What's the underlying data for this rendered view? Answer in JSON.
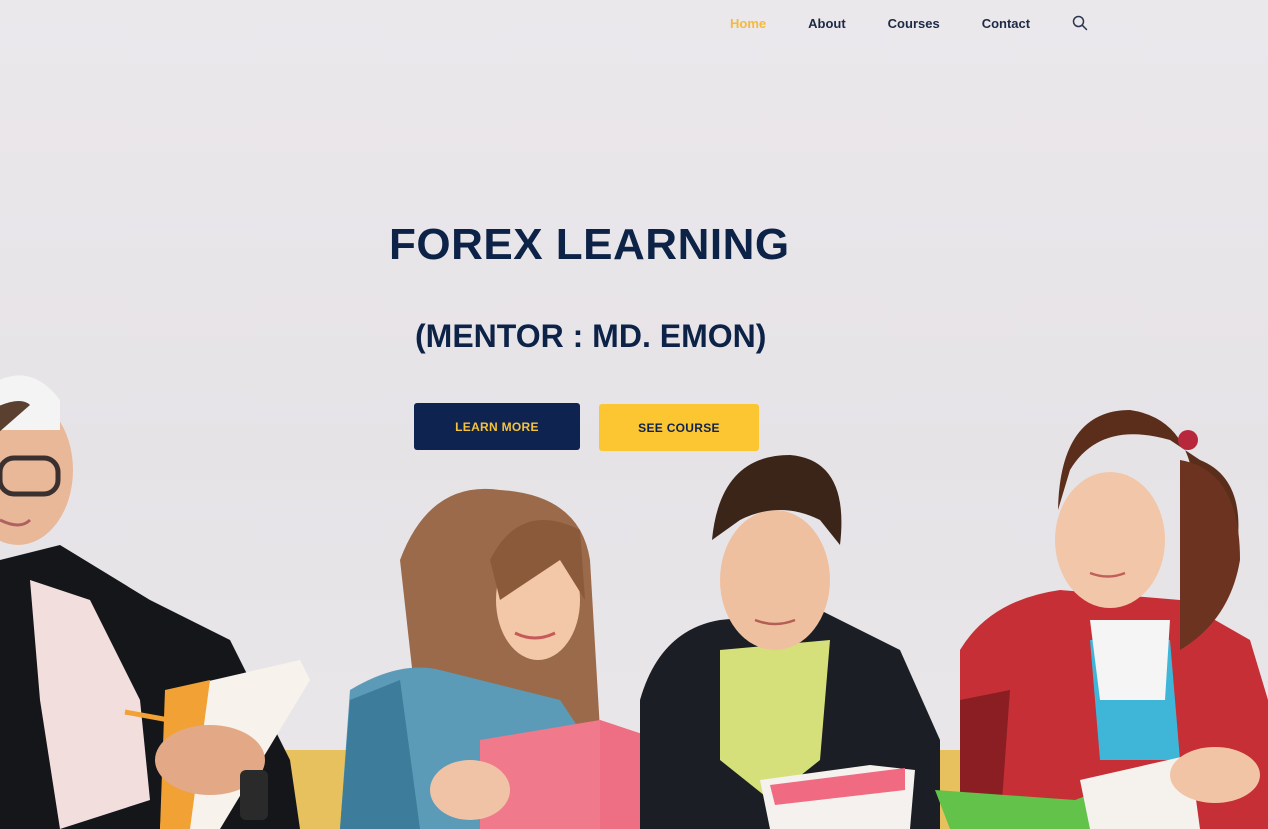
{
  "nav": {
    "items": [
      {
        "label": "Home",
        "active": true
      },
      {
        "label": "About",
        "active": false
      },
      {
        "label": "Courses",
        "active": false
      },
      {
        "label": "Contact",
        "active": false
      }
    ],
    "search_icon": "search-icon"
  },
  "hero": {
    "title": "FOREX LEARNING",
    "subtitle": "(MENTOR : MD. EMON)",
    "primary_button": "LEARN MORE",
    "secondary_button": "SEE COURSE"
  },
  "colors": {
    "accent": "#f5b93c",
    "navy": "#0e2350",
    "yellow": "#fcc532",
    "background": "#e9e6ea"
  }
}
